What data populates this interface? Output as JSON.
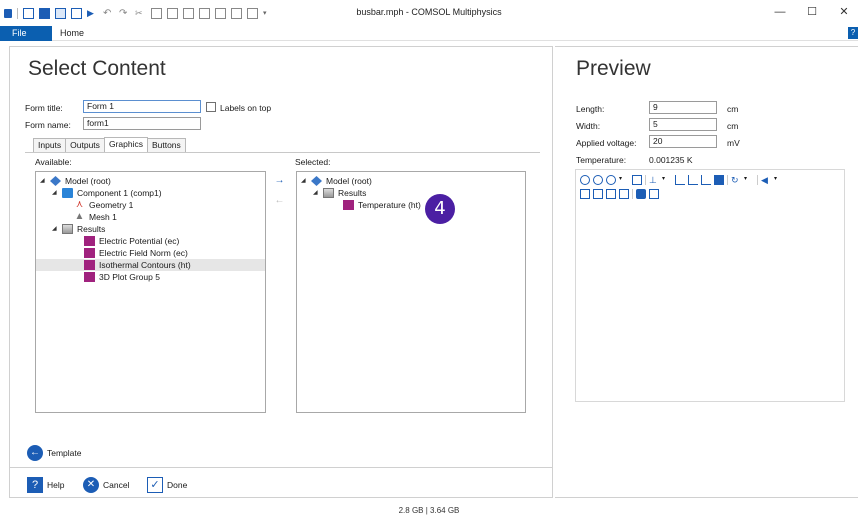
{
  "window": {
    "title": "busbar.mph - COMSOL Multiphysics",
    "minimize": "—",
    "maximize": "☐",
    "close": "✕"
  },
  "menu": {
    "file": "File",
    "home": "Home",
    "help": "?"
  },
  "select_content": {
    "title": "Select Content",
    "form_title_label": "Form title:",
    "form_title_value": "Form 1",
    "labels_on_top": "Labels on top",
    "form_name_label": "Form name:",
    "form_name_value": "form1",
    "tabs": [
      "Inputs",
      "Outputs",
      "Graphics",
      "Buttons"
    ],
    "active_tab": "Graphics",
    "available_label": "Available:",
    "selected_label": "Selected:",
    "available_tree": [
      {
        "label": "Model (root)",
        "level": 0,
        "expanded": true,
        "icon": "model-icon"
      },
      {
        "label": "Component 1 (comp1)",
        "level": 1,
        "expanded": true,
        "icon": "component-icon"
      },
      {
        "label": "Geometry 1",
        "level": 2,
        "icon": "geometry-icon"
      },
      {
        "label": "Mesh 1",
        "level": 2,
        "icon": "mesh-icon"
      },
      {
        "label": "Results",
        "level": 1,
        "expanded": true,
        "icon": "results-icon"
      },
      {
        "label": "Electric Potential (ec)",
        "level": 2,
        "icon": "plot-group-icon"
      },
      {
        "label": "Electric Field Norm (ec)",
        "level": 2,
        "icon": "plot-group-icon"
      },
      {
        "label": "Isothermal Contours (ht)",
        "level": 2,
        "icon": "plot-group-icon",
        "selected": true
      },
      {
        "label": "3D Plot Group 5",
        "level": 2,
        "icon": "plot-group-icon"
      }
    ],
    "selected_tree": [
      {
        "label": "Model (root)",
        "level": 0,
        "expanded": true,
        "icon": "model-icon"
      },
      {
        "label": "Results",
        "level": 1,
        "expanded": true,
        "icon": "results-icon"
      },
      {
        "label": "Temperature (ht)",
        "level": 2,
        "icon": "plot-group-icon"
      }
    ],
    "step_badge": "4",
    "template_label": "Template",
    "help_label": "Help",
    "cancel_label": "Cancel",
    "done_label": "Done"
  },
  "preview": {
    "title": "Preview",
    "rows": [
      {
        "label": "Length:",
        "value": "9",
        "unit": "cm"
      },
      {
        "label": "Width:",
        "value": "5",
        "unit": "cm"
      },
      {
        "label": "Applied voltage:",
        "value": "20",
        "unit": "mV"
      }
    ],
    "temperature_label": "Temperature:",
    "temperature_value": "0.001235 K"
  },
  "status": {
    "memory": "2.8 GB | 3.64 GB"
  },
  "colors": {
    "accent": "#0b5fb0",
    "badge": "#4b1fa3",
    "plot_group": "#a0227e",
    "model": "#3b78c8"
  }
}
